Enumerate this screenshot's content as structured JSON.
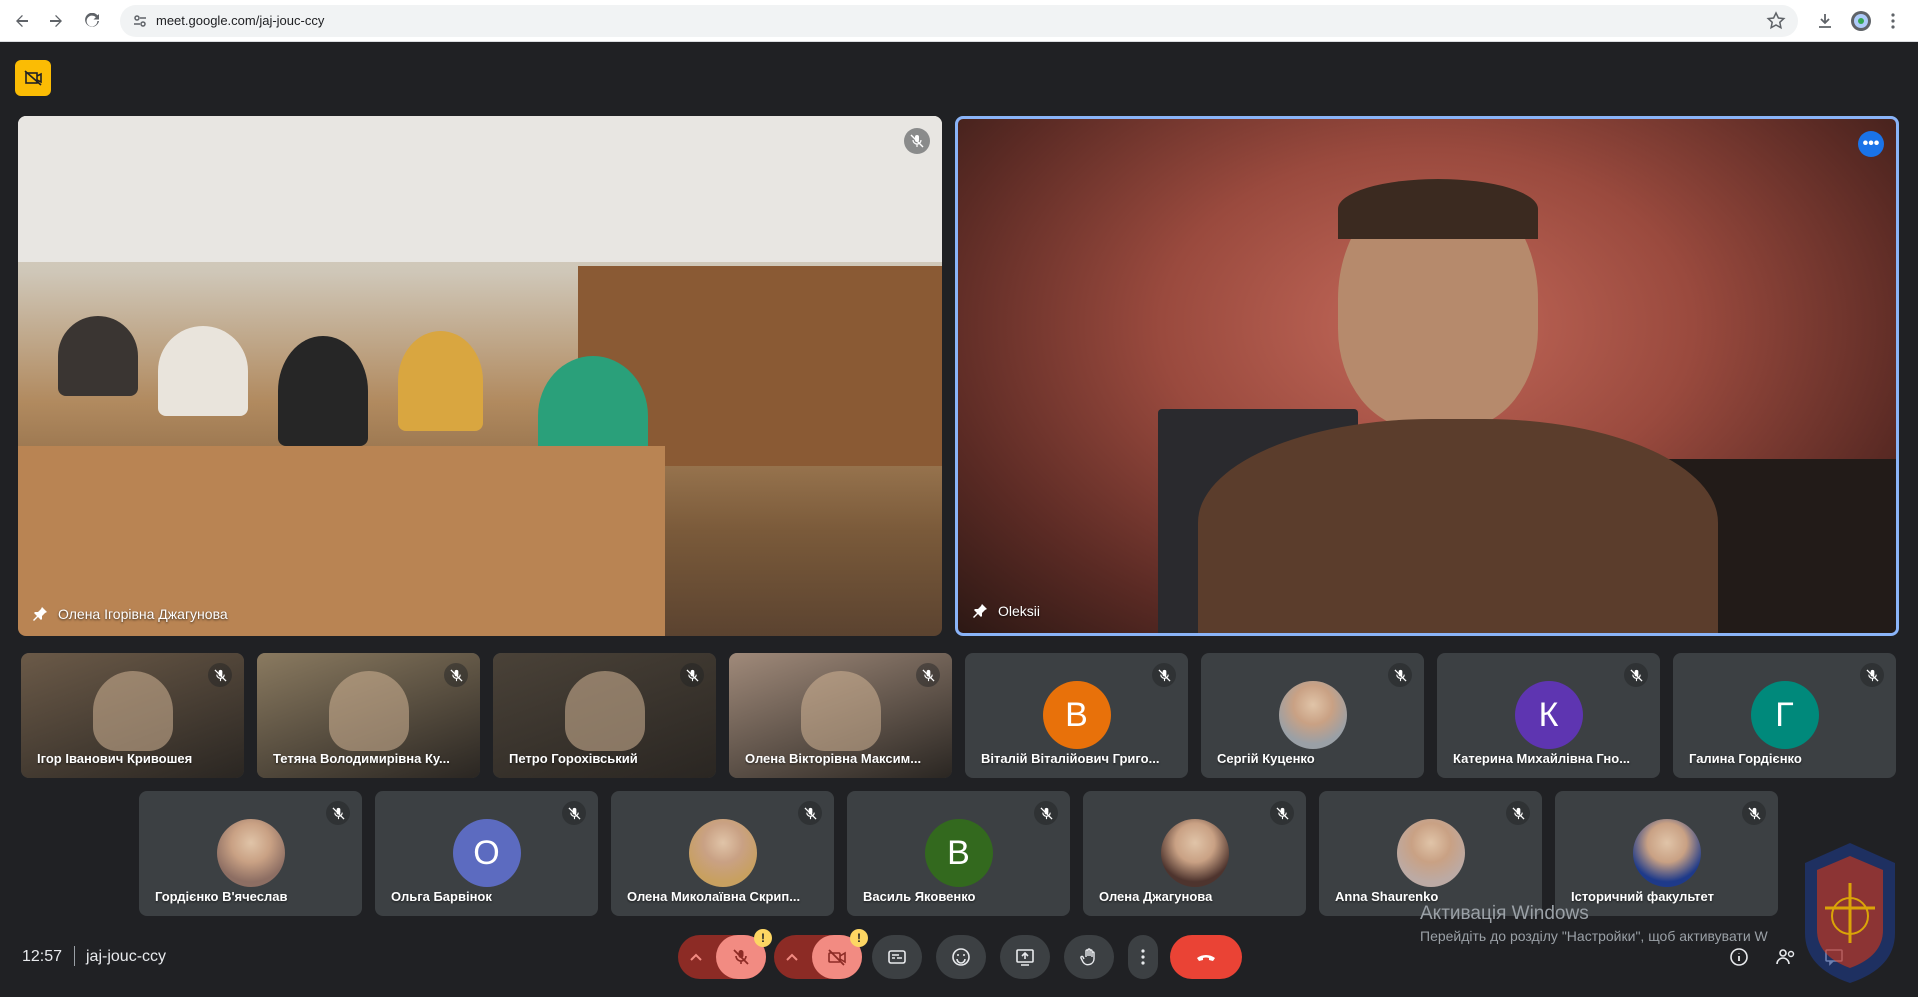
{
  "browser": {
    "url": "meet.google.com/jaj-jouc-ccy",
    "icons": {
      "back": "back-arrow-icon",
      "forward": "forward-arrow-icon",
      "reload": "reload-icon",
      "site_info": "site-info-icon",
      "bookmark": "star-icon",
      "download": "download-icon",
      "profile": "profile-icon",
      "menu": "more-vert-icon"
    }
  },
  "meeting": {
    "time": "12:57",
    "code": "jaj-jouc-ccy"
  },
  "main_tiles": [
    {
      "name": "Олена Ігорівна Джагунова"
    },
    {
      "name": "Oleksii"
    }
  ],
  "row1": [
    {
      "name": "Ігор Іванович Кривошея",
      "type": "video",
      "color": "#6b5a48"
    },
    {
      "name": "Тетяна Володимирівна Ку...",
      "type": "video",
      "color": "#8a7a60"
    },
    {
      "name": "Петро Горохівський",
      "type": "video",
      "color": "#4a4238"
    },
    {
      "name": "Олена Вікторівна Максим...",
      "type": "video",
      "color": "#a08a7a"
    },
    {
      "name": "Віталій Віталійович Григо...",
      "type": "letter",
      "letter": "В",
      "color": "#e8710a"
    },
    {
      "name": "Сергій Куценко",
      "type": "photo",
      "color": "#9aa0a6"
    },
    {
      "name": "Катерина Михайлівна Гно...",
      "type": "letter",
      "letter": "К",
      "color": "#5e35b1"
    },
    {
      "name": "Галина Гордієнко",
      "type": "letter",
      "letter": "Г",
      "color": "#00897b"
    }
  ],
  "row2": [
    {
      "name": "Гордієнко В'ячеслав",
      "type": "photo",
      "color": "#8d6e63"
    },
    {
      "name": "Ольга Барвінок",
      "type": "letter",
      "letter": "О",
      "color": "#5c6bc0"
    },
    {
      "name": "Олена Миколаївна Скрип...",
      "type": "photo",
      "color": "#c8a060"
    },
    {
      "name": "Василь Яковенко",
      "type": "letter",
      "letter": "В",
      "color": "#33691e"
    },
    {
      "name": "Олена Джагунова",
      "type": "photo",
      "color": "#4e342e"
    },
    {
      "name": "Anna Shaurenko",
      "type": "photo",
      "color": "#bcaaa4"
    },
    {
      "name": "Історичний факультет",
      "type": "photo",
      "color": "#1e3a8a"
    }
  ],
  "watermark": {
    "title": "Активація Windows",
    "subtitle": "Перейдіть до розділу \"Настройки\", щоб активувати W"
  },
  "colors": {
    "accent": "#8ab4f8",
    "end_call": "#ea4335",
    "warning": "#fdd663",
    "presenting": "#fbbc04"
  },
  "warning_badge": "!"
}
